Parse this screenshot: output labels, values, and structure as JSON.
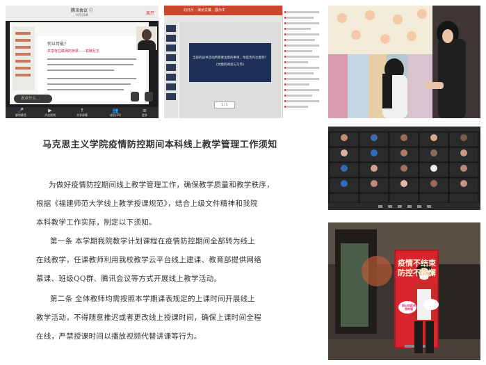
{
  "meeting": {
    "title": "腾讯会议 ⓘ",
    "subtitle": "共享屏幕",
    "leave": "离开",
    "question": "何以可能?",
    "slide_heading": "共享存在联网的桥梁——铁链尼乎",
    "chat_placeholder": "说点什么...",
    "controls": [
      {
        "icon": "🎤",
        "label": "解除静音"
      },
      {
        "icon": "▶",
        "label": "开启视频"
      },
      {
        "icon": "↑",
        "label": "共享屏幕"
      },
      {
        "icon": "👥",
        "label": "成员(35)"
      },
      {
        "icon": "≡",
        "label": "更多"
      }
    ]
  },
  "ppt": {
    "ribbon_title": "幻灯片 - 演示文稿 - 展示中",
    "slide_line1": "当前的读书活动所需要注意的事项，你是否有注意到？",
    "slide_line2": "《文献的阅读与写作》",
    "page_label": "1 / 1"
  },
  "document": {
    "title": "马克思主义学院疫情防控期间本科线上教学管理工作须知",
    "lines": [
      "为做好疫情防控期间线上教学管理工作，确保教学质量和教学秩序，",
      "根据《福建师范大学线上教学授课规范》，结合上级文件精神和我院",
      "本科教学工作实际，制定以下须知。",
      "第一条  本学期我院教学计划课程在疫情防控期间全部转为线上",
      "在线教学，任课教师利用我校教学云平台线上建课、教育部提供网络",
      "慕课、班级QQ群、腾讯会议等方式开展线上教学活动。",
      "第二条  全体教师均需按照本学期课表规定的上课时间开展线上",
      "教学活动，不得随意推迟或者更改线上授课时间，确保上课时间全程",
      "在线，严禁授课时间以播放视频代替讲课等行为。"
    ]
  },
  "banner": {
    "line1": "疫情不结束",
    "line2": "防控不松懈",
    "placard": "同心抗疫共克时艰"
  },
  "colors": {
    "leave_red": "#e53935",
    "ppt_ribbon": "#c9472c",
    "banner_red": "#d9232f"
  }
}
